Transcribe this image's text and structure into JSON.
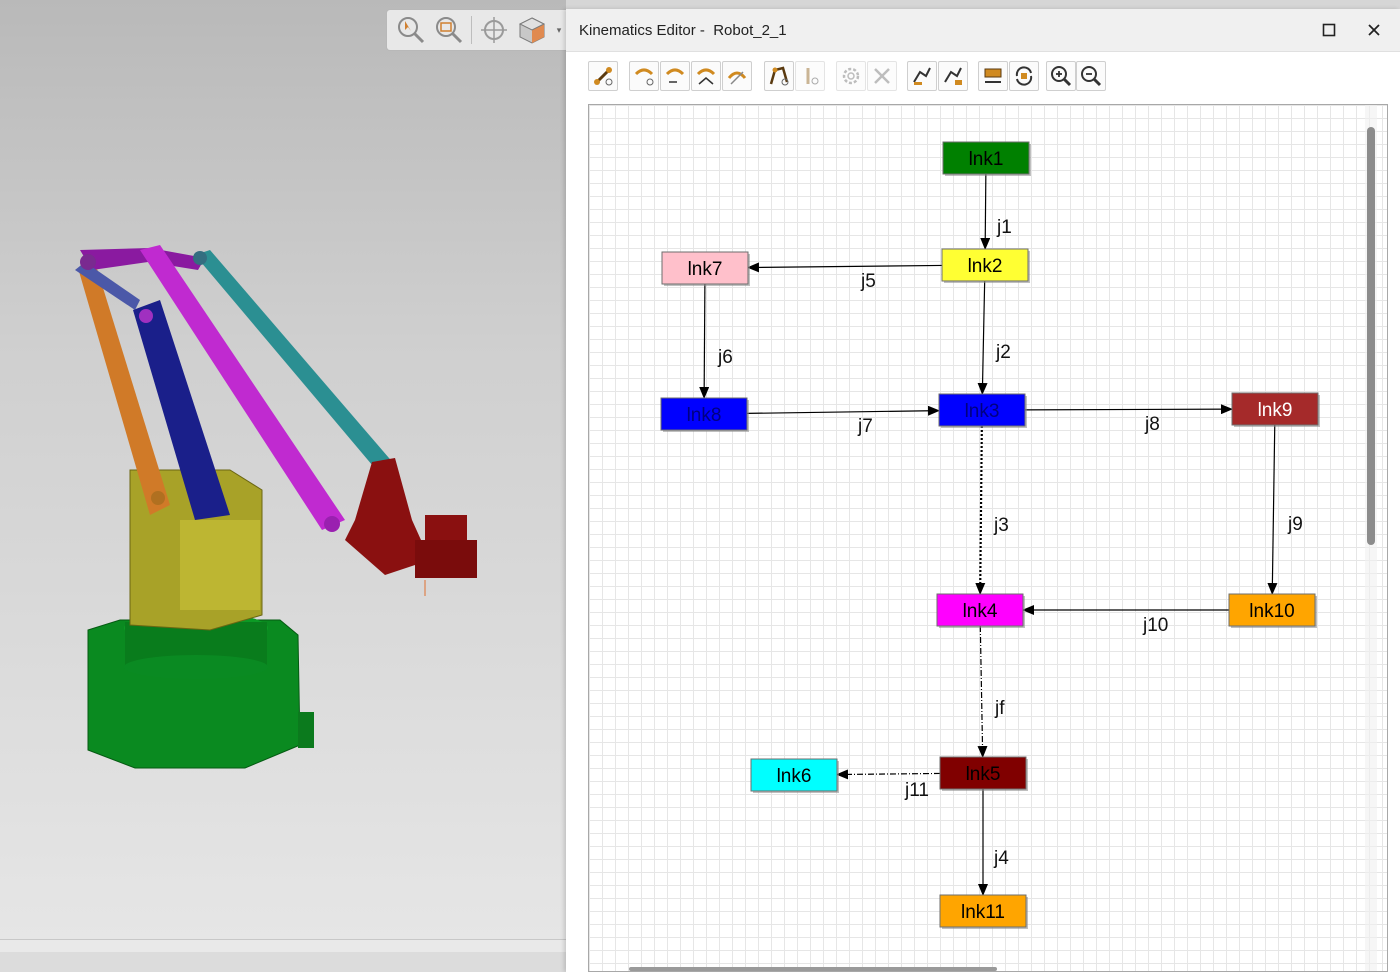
{
  "window": {
    "title": "Kinematics Editor -  Robot_2_1",
    "maximize_icon": "maximize-icon",
    "close_icon": "close-icon"
  },
  "view_toolbar": {
    "buttons": [
      "select-zoom-icon",
      "zoom-window-icon",
      "fit-target-icon",
      "view-cube-icon"
    ]
  },
  "toolbar": {
    "buttons": [
      "create-link-icon",
      "create-joint-icon",
      "edit-joint-icon",
      "joint-limits-icon",
      "joint-dependency-icon",
      "crank-icon",
      "set-zero-icon",
      "settings-icon",
      "delete-icon",
      "set-base-icon",
      "set-tool-icon",
      "open-chain-icon",
      "refresh-layout-icon",
      "zoom-in-icon",
      "zoom-out-icon"
    ]
  },
  "graph": {
    "nodes": [
      {
        "id": "lnk1",
        "label": "lnk1",
        "fill": "#008000",
        "text": "#000000"
      },
      {
        "id": "lnk2",
        "label": "lnk2",
        "fill": "#ffff33",
        "text": "#000000"
      },
      {
        "id": "lnk7",
        "label": "lnk7",
        "fill": "#ffc0cb",
        "text": "#000000"
      },
      {
        "id": "lnk8",
        "label": "lnk8",
        "fill": "#0000ff",
        "text": "#000080"
      },
      {
        "id": "lnk3",
        "label": "lnk3",
        "fill": "#0000ff",
        "text": "#000080"
      },
      {
        "id": "lnk9",
        "label": "lnk9",
        "fill": "#a52a2a",
        "text": "#ffffff"
      },
      {
        "id": "lnk4",
        "label": "lnk4",
        "fill": "#ff00ff",
        "text": "#000000"
      },
      {
        "id": "lnk10",
        "label": "lnk10",
        "fill": "#ffa500",
        "text": "#000000"
      },
      {
        "id": "lnk5",
        "label": "lnk5",
        "fill": "#800000",
        "text": "#000000"
      },
      {
        "id": "lnk6",
        "label": "lnk6",
        "fill": "#00ffff",
        "text": "#000000"
      },
      {
        "id": "lnk11",
        "label": "lnk11",
        "fill": "#ffa500",
        "text": "#000000"
      }
    ],
    "edges": [
      {
        "from": "lnk1",
        "to": "lnk2",
        "label": "j1",
        "style": "solid"
      },
      {
        "from": "lnk2",
        "to": "lnk7",
        "label": "j5",
        "style": "solid"
      },
      {
        "from": "lnk2",
        "to": "lnk3",
        "label": "j2",
        "style": "solid"
      },
      {
        "from": "lnk7",
        "to": "lnk8",
        "label": "j6",
        "style": "solid"
      },
      {
        "from": "lnk8",
        "to": "lnk3",
        "label": "j7",
        "style": "solid"
      },
      {
        "from": "lnk3",
        "to": "lnk9",
        "label": "j8",
        "style": "solid"
      },
      {
        "from": "lnk3",
        "to": "lnk4",
        "label": "j3",
        "style": "dotted"
      },
      {
        "from": "lnk9",
        "to": "lnk10",
        "label": "j9",
        "style": "solid"
      },
      {
        "from": "lnk10",
        "to": "lnk4",
        "label": "j10",
        "style": "solid"
      },
      {
        "from": "lnk4",
        "to": "lnk5",
        "label": "jf",
        "style": "dashdot"
      },
      {
        "from": "lnk5",
        "to": "lnk6",
        "label": "j11",
        "style": "dashdot"
      },
      {
        "from": "lnk5",
        "to": "lnk11",
        "label": "j4",
        "style": "solid"
      }
    ]
  }
}
